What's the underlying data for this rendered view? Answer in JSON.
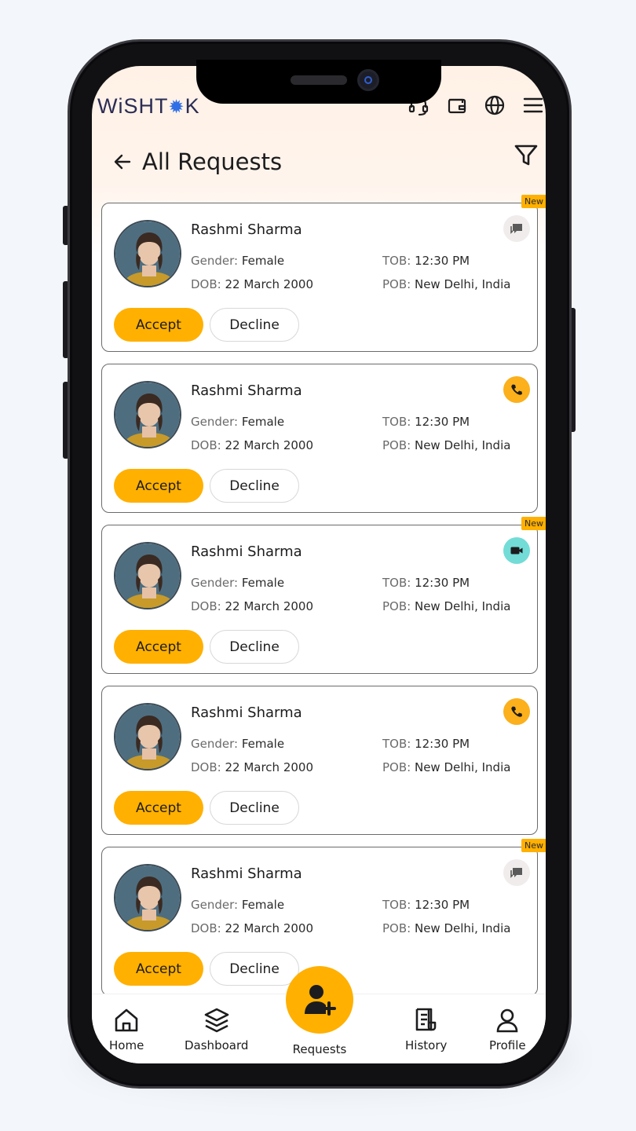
{
  "app": {
    "logo_text_left": "WiSHT",
    "logo_sun": "✹",
    "logo_text_right": "K"
  },
  "header": {
    "title": "All Requests",
    "icons": [
      "support-headset-icon",
      "wallet-icon",
      "globe-icon",
      "hamburger-menu-icon"
    ]
  },
  "requests": [
    {
      "name": "Rashmi Sharma",
      "gender_label": "Gender: ",
      "gender": "Female",
      "tob_label": "TOB: ",
      "tob": "12:30 PM",
      "dob_label": "DOB: ",
      "dob": "22 March 2000",
      "pob_label": "POB: ",
      "pob": "New Delhi, India",
      "accept": "Accept",
      "decline": "Decline",
      "type": "chat",
      "new_label": "New"
    },
    {
      "name": "Rashmi Sharma",
      "gender_label": "Gender: ",
      "gender": "Female",
      "tob_label": "TOB: ",
      "tob": "12:30 PM",
      "dob_label": "DOB: ",
      "dob": "22 March 2000",
      "pob_label": "POB: ",
      "pob": "New Delhi, India",
      "accept": "Accept",
      "decline": "Decline",
      "type": "call",
      "new_label": ""
    },
    {
      "name": "Rashmi Sharma",
      "gender_label": "Gender: ",
      "gender": "Female",
      "tob_label": "TOB: ",
      "tob": "12:30 PM",
      "dob_label": "DOB: ",
      "dob": "22 March 2000",
      "pob_label": "POB: ",
      "pob": "New Delhi, India",
      "accept": "Accept",
      "decline": "Decline",
      "type": "video",
      "new_label": "New"
    },
    {
      "name": "Rashmi Sharma",
      "gender_label": "Gender: ",
      "gender": "Female",
      "tob_label": "TOB: ",
      "tob": "12:30 PM",
      "dob_label": "DOB: ",
      "dob": "22 March 2000",
      "pob_label": "POB: ",
      "pob": "New Delhi, India",
      "accept": "Accept",
      "decline": "Decline",
      "type": "call",
      "new_label": ""
    },
    {
      "name": "Rashmi Sharma",
      "gender_label": "Gender: ",
      "gender": "Female",
      "tob_label": "TOB: ",
      "tob": "12:30 PM",
      "dob_label": "DOB: ",
      "dob": "22 March 2000",
      "pob_label": "POB: ",
      "pob": "New Delhi, India",
      "accept": "Accept",
      "decline": "Decline",
      "type": "chat",
      "new_label": "New"
    }
  ],
  "nav": {
    "home": "Home",
    "dashboard": "Dashboard",
    "requests": "Requests",
    "history": "History",
    "profile": "Profile"
  },
  "colors": {
    "accent": "#ffb000",
    "video_badge": "#73dcd7",
    "chat_badge": "#f1ecec",
    "logo_navy": "#2b2c55"
  }
}
